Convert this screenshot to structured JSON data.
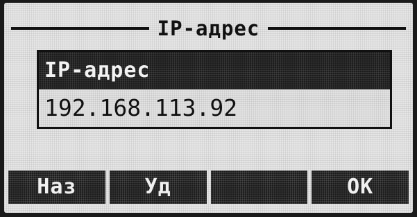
{
  "screen": {
    "title": "IP-адрес"
  },
  "field": {
    "label": "IP-адрес",
    "value": "192.168.113.92"
  },
  "softkeys": [
    {
      "label": "Наз"
    },
    {
      "label": "Уд"
    },
    {
      "label": ""
    },
    {
      "label": "OK"
    }
  ]
}
